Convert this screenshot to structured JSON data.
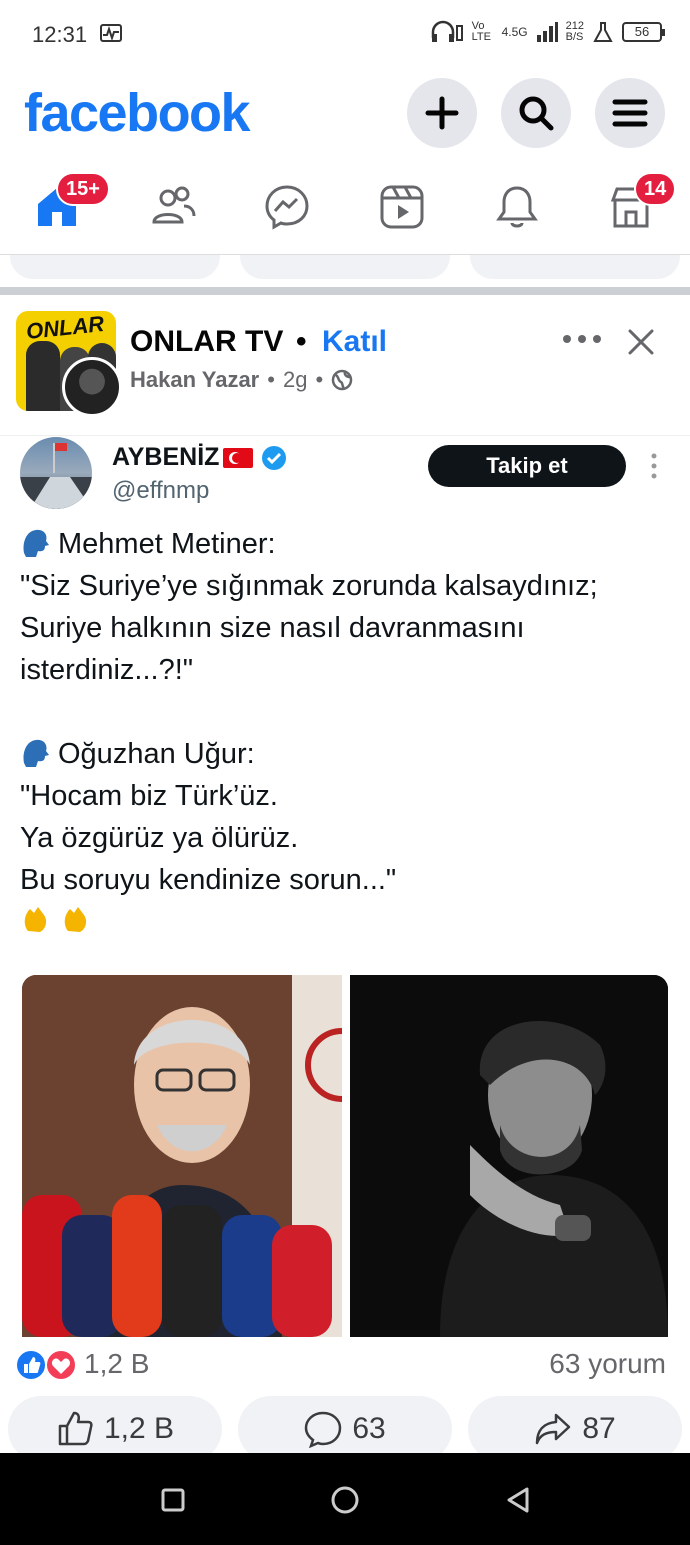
{
  "status_bar": {
    "time": "12:31",
    "network": "4.5G",
    "speed_value": "212",
    "speed_unit": "B/S",
    "volte": "Vo LTE",
    "battery": "56"
  },
  "header": {
    "logo": "facebook",
    "buttons": [
      "plus-icon",
      "search-icon",
      "menu-icon"
    ]
  },
  "nav": {
    "home_badge": "15+",
    "marketplace_badge": "14",
    "items": [
      "home-icon",
      "friends-icon",
      "messenger-icon",
      "video-icon",
      "notifications-icon",
      "marketplace-icon"
    ]
  },
  "post": {
    "group_name": "ONLAR TV",
    "separator": "•",
    "join_label": "Katıl",
    "author": "Hakan Yazar",
    "time": "2g",
    "meta_dot": "•",
    "group_avatar_text": "ONLAR"
  },
  "tweet": {
    "display_name": "AYBENİZ",
    "handle": "@effnmp",
    "follow_label": "Takip et",
    "speaker1": "Mehmet Metiner:",
    "quote1": "\"Siz Suriye’ye sığınmak zorunda kalsaydınız;\nSuriye halkının size nasıl davranmasını\nisterdiniz...?!\"",
    "speaker2": "Oğuzhan Uğur:",
    "quote2": "\"Hocam biz Türk’üz.\nYa özgürüz ya ölürüz.\nBu soruyu kendinize sorun...\""
  },
  "engagement": {
    "reactions_count": "1,2 B",
    "comments_label": "63 yorum",
    "like_count": "1,2 B",
    "comment_count": "63",
    "share_count": "87"
  },
  "colors": {
    "brand": "#1877f2",
    "badge": "#e41e3f",
    "pill_bg": "#f0f2f5"
  }
}
